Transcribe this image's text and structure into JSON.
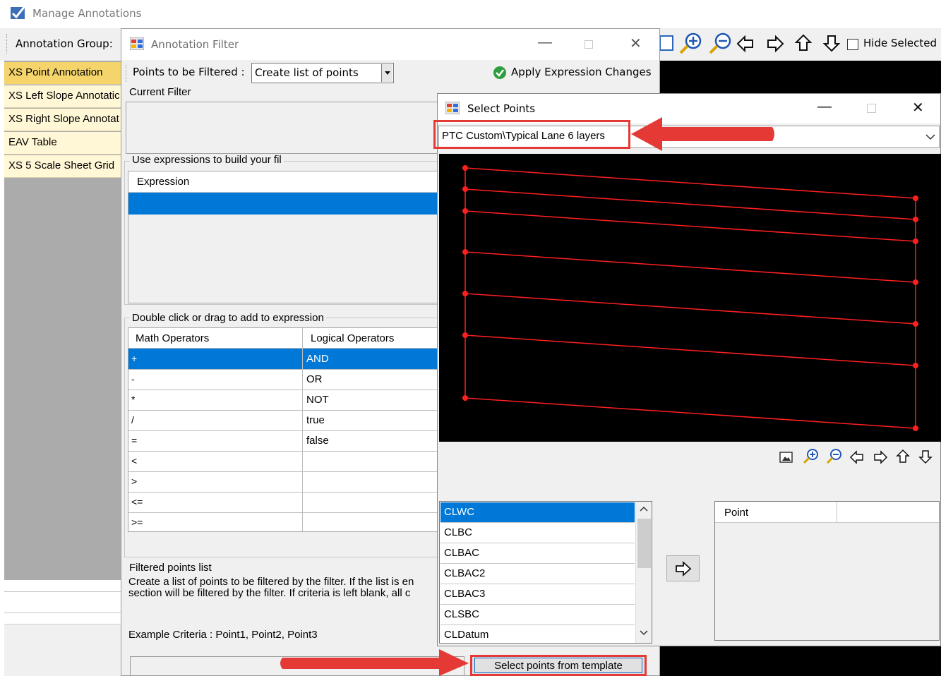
{
  "main_window": {
    "title": "Manage Annotations",
    "group_label": "Annotation Group:",
    "hide_selected_label": "Hide Selected",
    "groups": [
      {
        "label": "XS Point Annotation"
      },
      {
        "label": "XS Left Slope Annotatic"
      },
      {
        "label": "XS Right Slope Annotat"
      },
      {
        "label": "EAV Table"
      },
      {
        "label": "XS 5 Scale Sheet Grid"
      }
    ]
  },
  "annotation_filter": {
    "title": "Annotation Filter",
    "points_label": "Points to be Filtered :",
    "points_value": "Create list of points",
    "apply_label": "Apply Expression Changes",
    "current_filter_label": "Current Filter",
    "expressions_label": "Use expressions to build your fil",
    "expression_header": "Expression",
    "operators_label": "Double click or drag to add to expression",
    "math_header": "Math Operators",
    "logical_header": "Logical Operators",
    "math_ops": [
      "+",
      "-",
      "*",
      "/",
      "=",
      "<",
      ">",
      "<=",
      ">="
    ],
    "logical_ops": [
      "AND",
      "OR",
      "NOT",
      "true",
      "false"
    ],
    "filtered_label": "Filtered points list",
    "filtered_desc_line1": "Create a list of points to be filtered by the filter. If the list is en",
    "filtered_desc_line2": "section will be filtered by the filter. If criteria is left blank, all c",
    "example": "Example Criteria : Point1, Point2, Point3",
    "select_from_template": "Select points from template"
  },
  "select_points": {
    "title": "Select Points",
    "template_value": "PTC Custom\\Typical Lane 6 layers",
    "points": [
      "CLWC",
      "CLBC",
      "CLBAC",
      "CLBAC2",
      "CLBAC3",
      "CLSBC",
      "CLDatum"
    ],
    "point_header": "Point"
  },
  "colors": {
    "selection": "#0078d7",
    "annotation_red": "#e53935",
    "group_selected": "#f5d46b",
    "group_bg": "#fff7d6"
  }
}
